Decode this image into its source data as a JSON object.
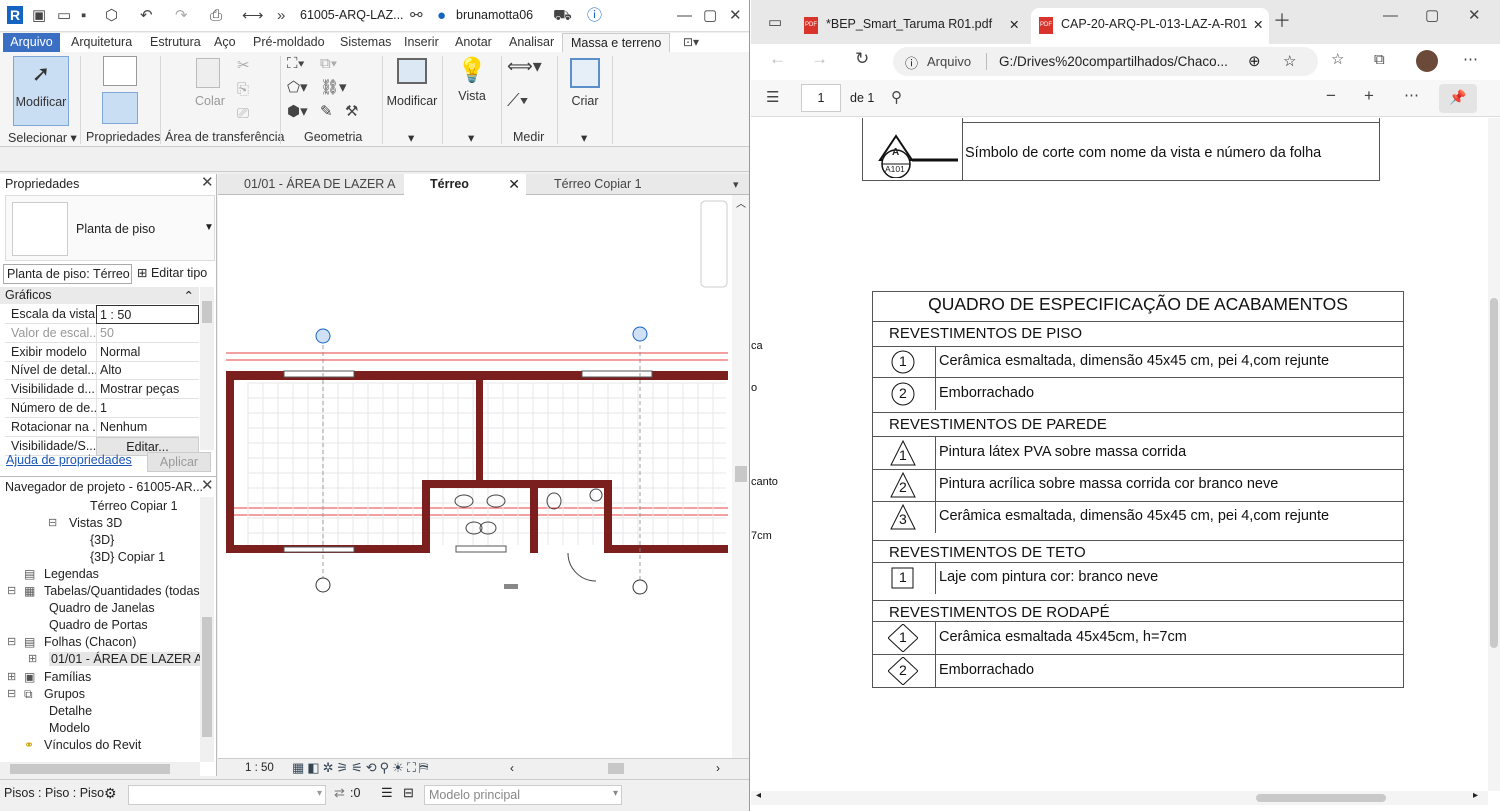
{
  "revit": {
    "qat": {
      "project_title": "61005-ARQ-LAZ...",
      "user": "brunamotta06"
    },
    "menu_tabs": [
      "Arquivo",
      "Arquitetura",
      "Estrutura",
      "Aço",
      "Pré-moldado",
      "Sistemas",
      "Inserir",
      "Anotar",
      "Analisar",
      "Massa e terreno"
    ],
    "ribbon": {
      "modify_label": "Modificar",
      "select_panel": "Selecionar",
      "properties_panel": "Propriedades",
      "clipboard_label": "Colar",
      "clipboard_panel": "Área de transferência",
      "geometry_panel": "Geometria",
      "modify2_label": "Modificar",
      "view_label": "Vista",
      "measure_panel": "Medir",
      "create_label": "Criar"
    },
    "properties": {
      "title": "Propriedades",
      "type_name": "Planta de piso",
      "instance_selector": "Planta de piso: Térreo",
      "edit_type": "Editar tipo",
      "section": "Gráficos",
      "rows": [
        {
          "k": "Escala da vista",
          "v": "1 : 50"
        },
        {
          "k": "Valor de escal...",
          "v": "50"
        },
        {
          "k": "Exibir modelo",
          "v": "Normal"
        },
        {
          "k": "Nível de detal...",
          "v": "Alto"
        },
        {
          "k": "Visibilidade d...",
          "v": "Mostrar peças"
        },
        {
          "k": "Número de de...",
          "v": "1"
        },
        {
          "k": "Rotacionar na ...",
          "v": "Nenhum"
        },
        {
          "k": "Visibilidade/S...",
          "v": "Editar..."
        }
      ],
      "help_link": "Ajuda de propriedades",
      "apply": "Aplicar"
    },
    "navigator": {
      "title": "Navegador de projeto - 61005-AR...",
      "items": [
        {
          "label": "Térreo Copiar 1",
          "indent": 90
        },
        {
          "label": "Vistas 3D",
          "indent": 69
        },
        {
          "label": "{3D}",
          "indent": 90
        },
        {
          "label": "{3D} Copiar 1",
          "indent": 90
        },
        {
          "label": "Legendas",
          "indent": 44
        },
        {
          "label": "Tabelas/Quantidades (todas)",
          "indent": 44
        },
        {
          "label": "Quadro de Janelas",
          "indent": 49
        },
        {
          "label": "Quadro de Portas",
          "indent": 49
        },
        {
          "label": "Folhas (Chacon)",
          "indent": 44
        },
        {
          "label": "01/01 - ÁREA DE LAZER A",
          "indent": 49
        },
        {
          "label": "Famílias",
          "indent": 44
        },
        {
          "label": "Grupos",
          "indent": 44
        },
        {
          "label": "Detalhe",
          "indent": 49
        },
        {
          "label": "Modelo",
          "indent": 49
        },
        {
          "label": "Vínculos do Revit",
          "indent": 44
        }
      ]
    },
    "view_tabs": [
      "01/01 - ÁREA DE LAZER A",
      "Térreo",
      "Térreo Copiar 1"
    ],
    "view_scale": "1 : 50",
    "status": {
      "left": "Pisos : Piso : Piso Ir",
      "count": ":0",
      "model": "Modelo principal"
    }
  },
  "browser": {
    "tabs": [
      "*BEP_Smart_Taruma R01.pdf",
      "CAP-20-ARQ-PL-013-LAZ-A-R01"
    ],
    "address_prefix": "Arquivo",
    "address": "G:/Drives%20compartilhados/Chaco...",
    "page_number": "1",
    "page_total": "de 1",
    "doc": {
      "section_marker_letter": "A",
      "section_marker_code": "A101",
      "section_symbol_text": "Símbolo de corte com nome da vista e número da folha",
      "table_title": "QUADRO DE ESPECIFICAÇÃO DE ACABAMENTOS",
      "side_fragments": [
        "ca",
        "o",
        "canto",
        "7cm"
      ],
      "groups": [
        {
          "title": "REVESTIMENTOS DE PISO",
          "symbol": "circle",
          "items": [
            {
              "n": "1",
              "text": "Cerâmica esmaltada, dimensão 45x45 cm, pei 4,com rejunte"
            },
            {
              "n": "2",
              "text": "Emborrachado"
            }
          ]
        },
        {
          "title": "REVESTIMENTOS DE PAREDE",
          "symbol": "triangle",
          "items": [
            {
              "n": "1",
              "text": "Pintura látex PVA sobre massa corrida"
            },
            {
              "n": "2",
              "text": "Pintura acrílica sobre massa corrida cor branco neve"
            },
            {
              "n": "3",
              "text": "Cerâmica esmaltada, dimensão 45x45 cm, pei 4,com rejunte"
            }
          ]
        },
        {
          "title": "REVESTIMENTOS DE TETO",
          "symbol": "square",
          "items": [
            {
              "n": "1",
              "text": "Laje com pintura cor: branco neve"
            }
          ]
        },
        {
          "title": "REVESTIMENTOS DE RODAPÉ",
          "symbol": "diamond",
          "items": [
            {
              "n": "1",
              "text": "Cerâmica esmaltada 45x45cm, h=7cm"
            },
            {
              "n": "2",
              "text": "Emborrachado"
            }
          ]
        }
      ]
    }
  },
  "colors": {
    "revit_accent": "#3a6fc4",
    "wall": "#7a1e1e",
    "dim_red": "#e00000",
    "pdf_red": "#d9342b"
  }
}
